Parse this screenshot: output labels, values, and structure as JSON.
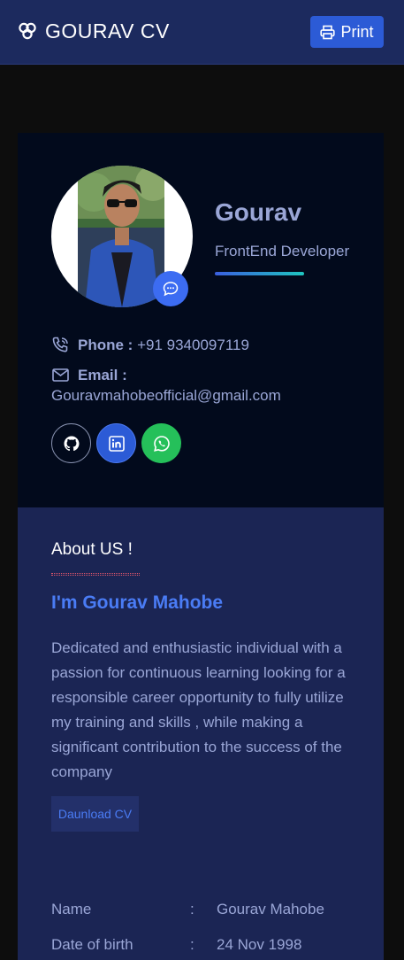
{
  "header": {
    "brand_icon": "three-circles-logo-icon",
    "title": "GOURAV CV",
    "print_label": "Print",
    "print_icon": "printer-icon"
  },
  "profile": {
    "name": "Gourav",
    "role": "FrontEnd Developer",
    "phone_label": "Phone :",
    "phone": "+91 9340097119",
    "email_label": "Email :",
    "email": "Gouravmahobeofficial@gmail.com",
    "socials": [
      "github-icon",
      "linkedin-icon",
      "whatsapp-icon"
    ]
  },
  "about": {
    "title": "About US !",
    "headline": "I'm Gourav Mahobe",
    "text": "Dedicated and enthusiastic individual with a passion for continuous learning looking for a responsible career opportunity to fully utilize my training and skills , while making a significant contribution to the success of the company",
    "download_label": "Daunload CV",
    "info": [
      {
        "key": "Name",
        "sep": ":",
        "value": "Gourav Mahobe"
      },
      {
        "key": "Date of birth",
        "sep": ":",
        "value": "24 Nov 1998"
      }
    ]
  },
  "colors": {
    "header_bg": "#1c2a5e",
    "accent": "#2c5bd6",
    "profile_bg": "#020a1c",
    "about_bg": "#1b2554",
    "muted_text": "#9aa6d6",
    "link_blue": "#4a7cf5",
    "whatsapp": "#25c05a"
  }
}
